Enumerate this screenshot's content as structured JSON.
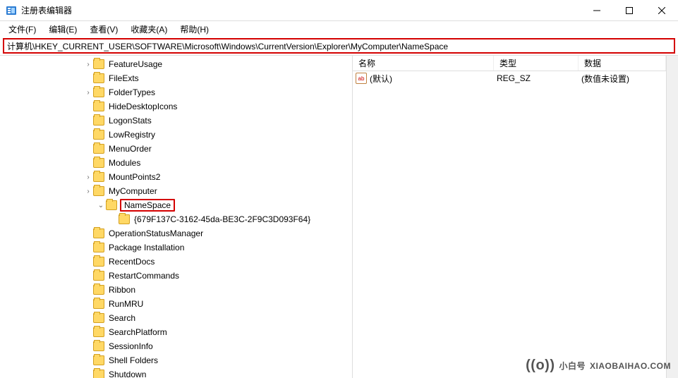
{
  "window": {
    "title": "注册表编辑器"
  },
  "menubar": {
    "file": "文件(F)",
    "edit": "编辑(E)",
    "view": "查看(V)",
    "favorites": "收藏夹(A)",
    "help": "帮助(H)"
  },
  "addressbar": {
    "path": "计算机\\HKEY_CURRENT_USER\\SOFTWARE\\Microsoft\\Windows\\CurrentVersion\\Explorer\\MyComputer\\NameSpace"
  },
  "tree": [
    {
      "depth": 1,
      "expander": "›",
      "label": "FeatureUsage"
    },
    {
      "depth": 1,
      "expander": "",
      "label": "FileExts"
    },
    {
      "depth": 1,
      "expander": "›",
      "label": "FolderTypes"
    },
    {
      "depth": 1,
      "expander": "",
      "label": "HideDesktopIcons"
    },
    {
      "depth": 1,
      "expander": "",
      "label": "LogonStats"
    },
    {
      "depth": 1,
      "expander": "",
      "label": "LowRegistry"
    },
    {
      "depth": 1,
      "expander": "",
      "label": "MenuOrder"
    },
    {
      "depth": 1,
      "expander": "",
      "label": "Modules"
    },
    {
      "depth": 1,
      "expander": "›",
      "label": "MountPoints2"
    },
    {
      "depth": 1,
      "expander": "›",
      "label": "MyComputer"
    },
    {
      "depth": 2,
      "expander": "⌄",
      "label": "NameSpace",
      "highlight": true
    },
    {
      "depth": 3,
      "expander": "",
      "label": "{679F137C-3162-45da-BE3C-2F9C3D093F64}"
    },
    {
      "depth": 1,
      "expander": "",
      "label": "OperationStatusManager"
    },
    {
      "depth": 1,
      "expander": "",
      "label": "Package Installation"
    },
    {
      "depth": 1,
      "expander": "",
      "label": "RecentDocs"
    },
    {
      "depth": 1,
      "expander": "",
      "label": "RestartCommands"
    },
    {
      "depth": 1,
      "expander": "",
      "label": "Ribbon"
    },
    {
      "depth": 1,
      "expander": "",
      "label": "RunMRU"
    },
    {
      "depth": 1,
      "expander": "",
      "label": "Search"
    },
    {
      "depth": 1,
      "expander": "",
      "label": "SearchPlatform"
    },
    {
      "depth": 1,
      "expander": "",
      "label": "SessionInfo"
    },
    {
      "depth": 1,
      "expander": "",
      "label": "Shell Folders"
    },
    {
      "depth": 1,
      "expander": "",
      "label": "Shutdown"
    }
  ],
  "list": {
    "columns": {
      "name": "名称",
      "type": "类型",
      "data": "数据"
    },
    "rows": [
      {
        "name": "(默认)",
        "icon": "ab",
        "type": "REG_SZ",
        "data": "(数值未设置)"
      }
    ]
  },
  "watermark": {
    "brand": "小白号",
    "domain": "XIAOBAIHAO.COM"
  }
}
